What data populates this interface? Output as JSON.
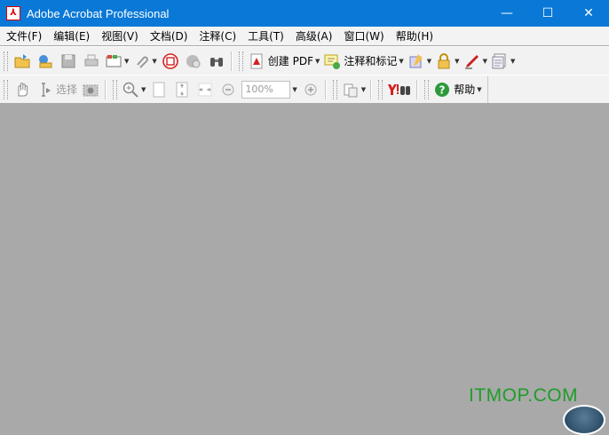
{
  "window": {
    "title": "Adobe Acrobat Professional",
    "app_icon_glyph": "⅄",
    "controls": {
      "minimize": "—",
      "maximize": "☐",
      "close": "✕"
    }
  },
  "menu": [
    "文件(F)",
    "编辑(E)",
    "视图(V)",
    "文档(D)",
    "注释(C)",
    "工具(T)",
    "高级(A)",
    "窗口(W)",
    "帮助(H)"
  ],
  "toolbar1": {
    "create_pdf_label": "创建 PDF",
    "comment_label": "注释和标记"
  },
  "toolbar2": {
    "select_label": "选择",
    "zoom_value": "100%",
    "help_label": "帮助"
  },
  "watermark": "ITMOP.COM",
  "colors": {
    "titlebar": "#0a78d7",
    "workspace": "#a9a9a9",
    "toolbar": "#f2f2f2",
    "watermark": "#1f9d2a"
  }
}
